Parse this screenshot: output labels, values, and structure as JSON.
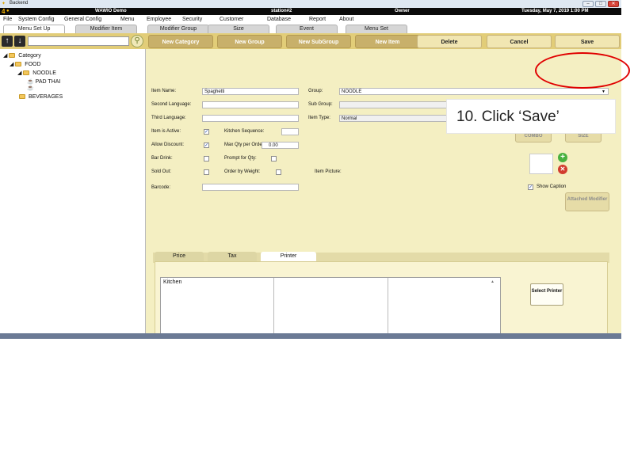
{
  "window": {
    "title": "Backend",
    "app_name": "WAWIO Demo",
    "station": "station#2",
    "user": "Owner",
    "datetime": "Tuesday, May 7, 2019 1:00 PM",
    "logo_text": "4"
  },
  "menu": [
    "File",
    "System Config",
    "General Config",
    "Menu",
    "Employee",
    "Security",
    "Customer",
    "Database",
    "Report",
    "About"
  ],
  "tabs": [
    "Menu Set Up",
    "Modifier Item",
    "Modifier Group",
    "Size",
    "Event",
    "Menu Set"
  ],
  "toolbar": {
    "new_category": "New Category",
    "new_group": "New Group",
    "new_subgroup": "New SubGroup",
    "new_item": "New Item",
    "delete": "Delete",
    "cancel": "Cancel",
    "save": "Save"
  },
  "tree": {
    "root": "Category",
    "food": "FOOD",
    "noodle": "NOODLE",
    "pad_thai": "PAD THAI",
    "beverages": "BEVERAGES"
  },
  "form": {
    "item_name_label": "Item Name:",
    "item_name_value": "Spaghetti",
    "second_language_label": "Second Language:",
    "third_language_label": "Third Language:",
    "item_active_label": "Item is Active:",
    "kitchen_sequence_label": "Kitchen Sequence:",
    "allow_discount_label": "Allow Discount:",
    "max_qty_label": "Max Qty per Order:",
    "max_qty_value": "0.00",
    "bar_drink_label": "Bar Drink:",
    "prompt_qty_label": "Prompt for Qty:",
    "sold_out_label": "Sold Out:",
    "order_weight_label": "Order by Weight:",
    "item_picture_label": "Item Picture:",
    "barcode_label": "Barcode:",
    "group_label": "Group:",
    "group_value": "NOODLE",
    "sub_group_label": "Sub Group:",
    "item_type_label": "Item Type:",
    "item_type_value": "Normal",
    "combo": "COMBO",
    "size": "SIZE",
    "show_caption": "Show Caption",
    "attached_modifier": "Attached Modifier"
  },
  "subtabs": [
    "Price",
    "Tax",
    "Printer"
  ],
  "printer": {
    "kitchen": "Kitchen",
    "select_printer": "Select Printer"
  },
  "callout": "10. Click ‘Save’",
  "colors": {
    "toolbar": "#e2cd78",
    "form_bg": "#f4efc2",
    "highlight": "#e00000"
  }
}
